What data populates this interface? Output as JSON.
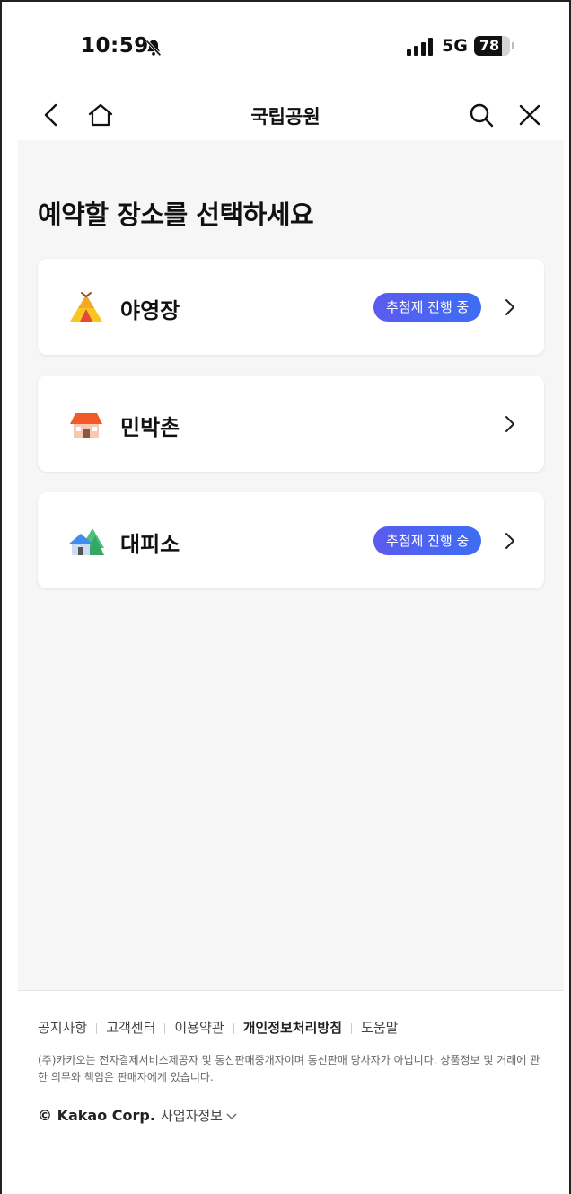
{
  "status_bar": {
    "time": "10:59",
    "network": "5G",
    "battery": "78",
    "battery_level": 0.78
  },
  "nav": {
    "title": "국립공원"
  },
  "main": {
    "title": "예약할 장소를 선택하세요",
    "cards": [
      {
        "label": "야영장",
        "badge": "추첨제 진행 중",
        "icon": "tent-icon"
      },
      {
        "label": "민박촌",
        "badge": "",
        "icon": "house-icon"
      },
      {
        "label": "대피소",
        "badge": "추첨제 진행 중",
        "icon": "shelter-icon"
      }
    ]
  },
  "footer": {
    "links": [
      "공지사항",
      "고객센터",
      "이용약관",
      "개인정보처리방침",
      "도움말"
    ],
    "description": "(주)카카오는 전자결제서비스제공자 및 통신판매중개자이며 통신판매 당사자가 아닙니다. 상품정보 및 거래에 관한 의무와 책임은 판매자에게 있습니다.",
    "copyright": "© Kakao Corp.",
    "company_info": "사업자정보"
  },
  "colors": {
    "badge_start": "#5b5bf0",
    "badge_end": "#3d6df2",
    "background": "#f6f6f6"
  }
}
